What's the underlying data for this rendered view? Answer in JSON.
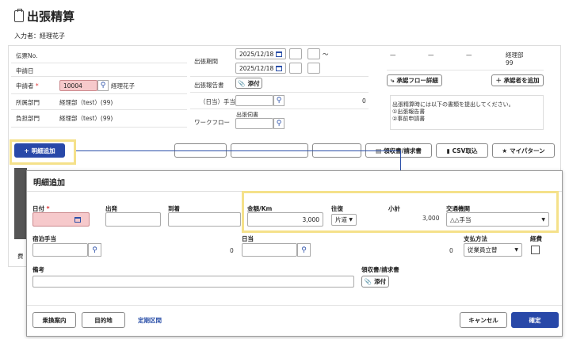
{
  "header": {
    "title": "出張精算",
    "inputter_label": "入力者：",
    "inputter_name": "経理花子"
  },
  "form": {
    "voucher_no_label": "伝票No.",
    "request_date_label": "申請日",
    "applicant_label": "申請者",
    "applicant_required": "*",
    "applicant_code": "10004",
    "applicant_name": "経理花子",
    "department_label": "所属部門",
    "department_value": "経理部（test）(99)",
    "charge_department_label": "負担部門",
    "charge_department_value": "経理部（test）(99)",
    "trip_period_label": "出張期間",
    "date_from": "2025/12/18",
    "date_to": "2025/12/18",
    "tilde": "〜",
    "report_label": "出張報告書",
    "attach_label": "添付",
    "allowance_label": "（日当）手当３",
    "allowance_value": "0",
    "workflow_label": "ワークフロー",
    "trip_request_label": "出張伺書"
  },
  "approval": {
    "cols": [
      "—",
      "—",
      "—",
      "経理部"
    ],
    "last_code": "99",
    "flow_button": "承認フロー詳細",
    "add_button": "＋ 承認者を追加",
    "notice_lines": [
      "出張精算時には以下の書類を提出してください。",
      "①出張報告書",
      "②事前申請書"
    ]
  },
  "toolbar": {
    "add_detail": "明細追加",
    "receipt": "領収書/請求書",
    "csv_import": "CSV取込",
    "my_pattern": "マイパターン"
  },
  "modal": {
    "title": "明細追加",
    "date_label": "日付",
    "date_required": "*",
    "depart_label": "出発",
    "arrive_label": "到着",
    "amount_label": "金額/Km",
    "amount_value": "3,000",
    "roundtrip_label": "往復",
    "roundtrip_value": "片道",
    "subtotal_label": "小計",
    "subtotal_value": "3,000",
    "transport_label": "交通機関",
    "transport_value": "△△手当",
    "lodging_label": "宿泊手当",
    "lodging_value": "0",
    "daily_label": "日当",
    "daily_value": "0",
    "payment_label": "支払方法",
    "payment_value": "従業員立替",
    "expense_label": "経費",
    "remarks_label": "備考",
    "receipt_label": "領収書/請求書",
    "attach_label": "添付",
    "transfer_button": "乗換案内",
    "destination_button": "目的地",
    "commuter_link": "定期区間",
    "cancel_button": "キャンセル",
    "confirm_button": "確定"
  },
  "background_left_text": "費",
  "colors": {
    "primary": "#2848a8",
    "highlight": "#f5e18a",
    "required_pink": "#f6c9cb"
  }
}
